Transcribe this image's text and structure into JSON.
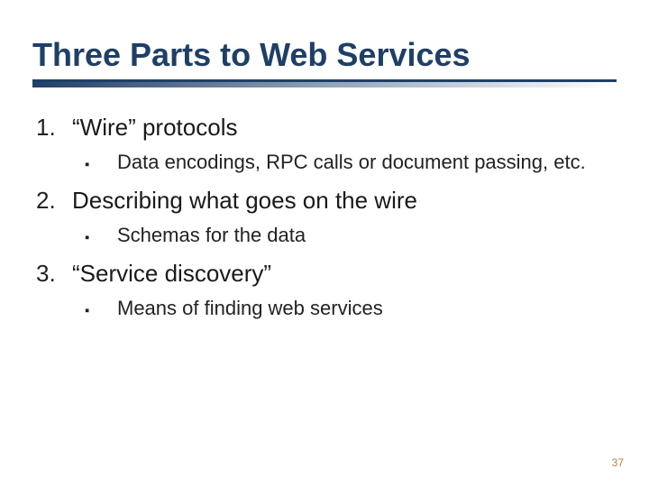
{
  "title": "Three Parts to Web Services",
  "items": [
    {
      "head": "“Wire” protocols",
      "sub": "Data encodings, RPC calls or document passing, etc."
    },
    {
      "head": "Describing what goes on the wire",
      "sub": "Schemas for the data"
    },
    {
      "head": "“Service discovery”",
      "sub": "Means of finding web services"
    }
  ],
  "bullet_glyph": "▪",
  "page_number": "37"
}
